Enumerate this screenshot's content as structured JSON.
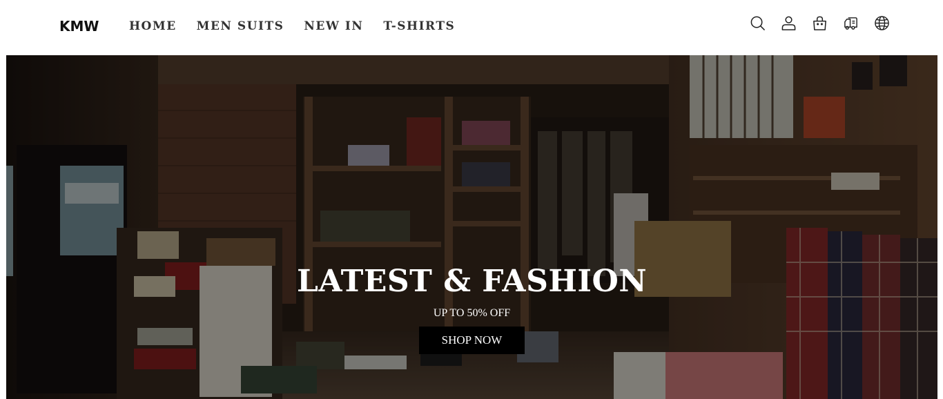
{
  "header": {
    "logo": "KMW",
    "nav": [
      {
        "label": "HOME"
      },
      {
        "label": "MEN SUITS"
      },
      {
        "label": "NEW IN"
      },
      {
        "label": "T-SHIRTS"
      }
    ],
    "icons": [
      "search-icon",
      "account-icon",
      "cart-icon",
      "shipping-icon",
      "globe-icon"
    ]
  },
  "hero": {
    "title": "LATEST & FASHION",
    "subtitle": "UP TO 50% OFF",
    "button_label": "SHOP NOW"
  },
  "colors": {
    "header_bg": "#ffffff",
    "nav_text": "#333333",
    "button_bg": "#000000",
    "hero_text": "#ffffff"
  }
}
